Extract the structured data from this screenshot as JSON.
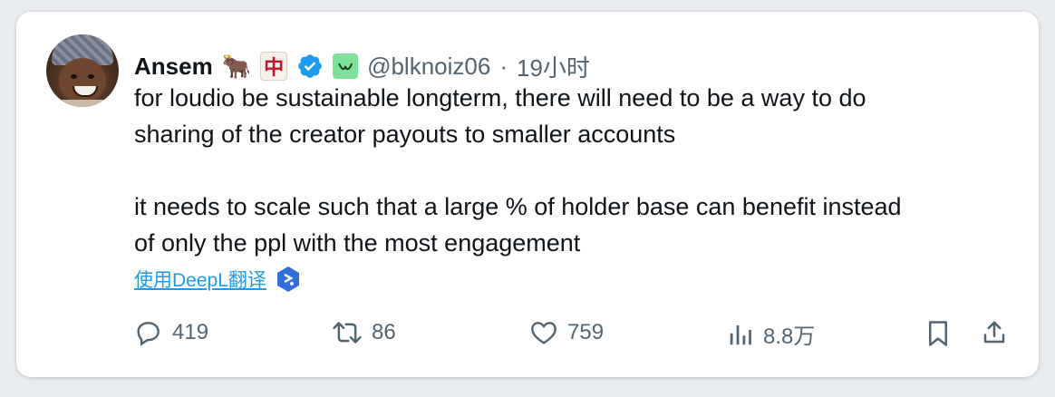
{
  "tweet": {
    "author_name": "Ansem",
    "name_emoji": "🐂",
    "name_badge_char": "中",
    "handle": "@blknoiz06",
    "separator": "·",
    "time": "19小时",
    "text_lines": [
      "for loudio be sustainable longterm, there will need to be a way to do",
      "sharing of the creator payouts to smaller accounts",
      "it needs to scale such that a large % of holder base can benefit instead",
      "of only the ppl with the most engagement"
    ],
    "translate_label": "使用DeepL翻译"
  },
  "actions": {
    "replies": "419",
    "retweets": "86",
    "likes": "759",
    "views": "8.8万"
  },
  "colors": {
    "text": "#0f1419",
    "muted": "#536471",
    "link": "#1d9bf0",
    "verified": "#1d9bf0",
    "affiliate_badge": "#7ee39a"
  }
}
